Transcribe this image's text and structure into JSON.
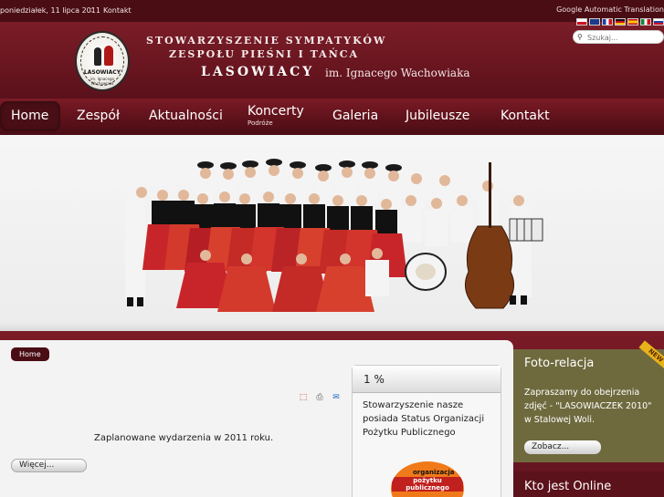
{
  "topbar": {
    "date": "poniedziałek, 11 lipca 2011",
    "contact": "Kontakt",
    "translate_label": "Google Automatic Translation"
  },
  "header": {
    "logo": {
      "text": "LASOWIACY",
      "subtext": "im. Ignacego Wachowiaka"
    },
    "title_line1": "STOWARZYSZENIE SYMPATYKÓW",
    "title_line2": "ZESPOŁU PIEŚNI I TAŃCA",
    "title_line3": "LASOWIACY",
    "title_line4": "im. Ignacego Wachowiaka"
  },
  "search": {
    "placeholder": "Szukaj..."
  },
  "nav": {
    "items": [
      {
        "label": "Home",
        "active": true
      },
      {
        "label": "Zespół"
      },
      {
        "label": "Aktualności"
      },
      {
        "label": "Koncerty",
        "sublabel": "Podróże"
      },
      {
        "label": "Galeria"
      },
      {
        "label": "Jubileusze"
      },
      {
        "label": "Kontakt"
      }
    ]
  },
  "breadcrumb": {
    "home": "Home"
  },
  "article": {
    "text": "Zaplanowane wydarzenia w 2011 roku.",
    "more_label": "Więcej..."
  },
  "opp": {
    "title": "1 %",
    "text": "Stowarzyszenie nasze posiada Status Organizacji Pożytku Publicznego",
    "badge_line1": "organizacja",
    "badge_line2": "pożytku publicznego"
  },
  "side": {
    "photo_title": "Foto-relacja",
    "photo_text": "Zapraszamy do obejrzenia zdjęć - \"LASOWIACZEK 2010\" w Stalowej Woli.",
    "photo_button": "Zobacz...",
    "ribbon": "NEW",
    "online_title": "Kto jest Online"
  },
  "colors": {
    "brand": "#6a1620",
    "panel_olive": "#6f6a3e",
    "dark": "#4a0d14"
  }
}
